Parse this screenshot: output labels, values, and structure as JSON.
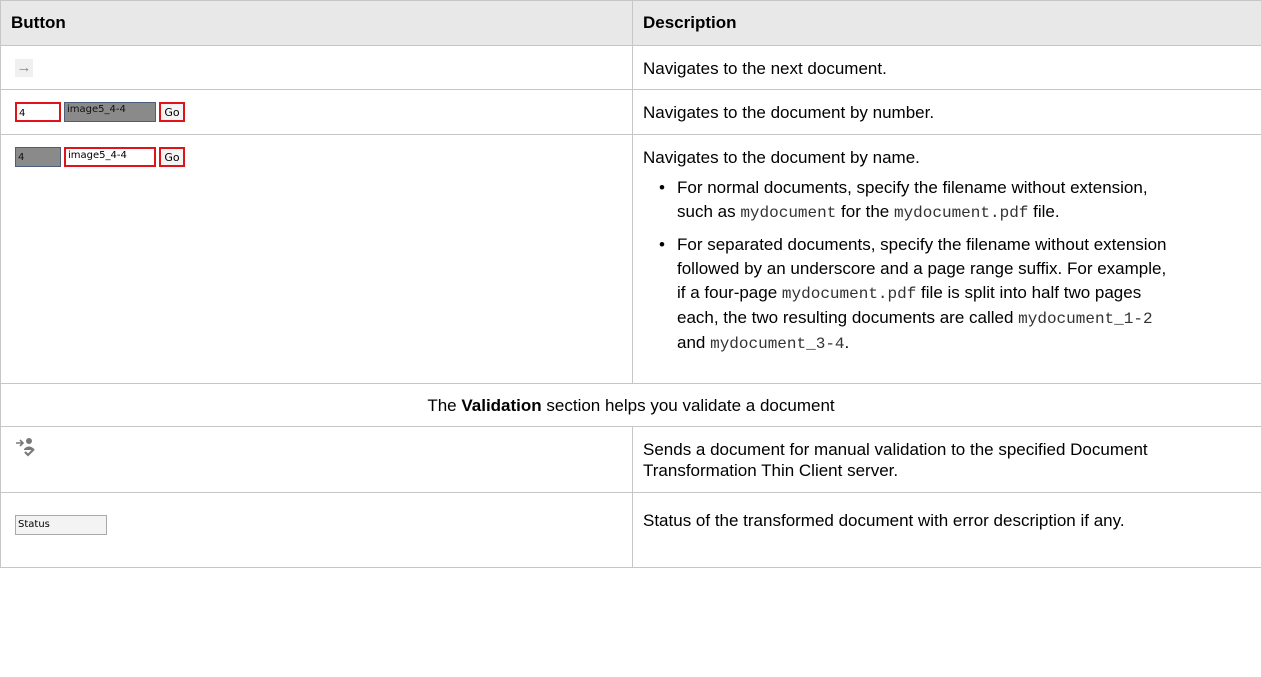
{
  "table": {
    "header": {
      "button": "Button",
      "description": "Description"
    },
    "rows": {
      "next": {
        "icon": "arrow-right-icon",
        "description": "Navigates to the next document."
      },
      "by_number": {
        "number_value": "4",
        "name_value": "image5_4-4",
        "go_label": "Go",
        "description": "Navigates to the document by number."
      },
      "by_name": {
        "number_value": "4",
        "name_value": "image5_4-4",
        "go_label": "Go",
        "description": "Navigates to the document by name.",
        "bullet1": {
          "text_a": "For normal documents, specify the filename without extension, such as ",
          "code_a": "mydocument",
          "text_b": " for the ",
          "code_b": "mydocument.pdf",
          "text_c": " file."
        },
        "bullet2": {
          "text_a": "For separated documents, specify the filename without extension followed by an underscore and a page range suffix. For example, if a four-page ",
          "code_a": "mydocument.pdf",
          "text_b": " file is split into half two pages each, the two resulting documents are called ",
          "code_b": "mydocument_1-2",
          "text_c": " and ",
          "code_c": "mydocument_3-4",
          "text_d": "."
        }
      },
      "section": {
        "prefix": "The ",
        "bold": "Validation",
        "suffix": " section helps you validate a document"
      },
      "manual_validation": {
        "icon": "send-for-validation-icon",
        "description": "Sends a document for manual validation to the specified Document Transformation Thin Client server."
      },
      "status": {
        "status_label": "Status",
        "description": "Status of the transformed document with error description if any."
      }
    }
  }
}
